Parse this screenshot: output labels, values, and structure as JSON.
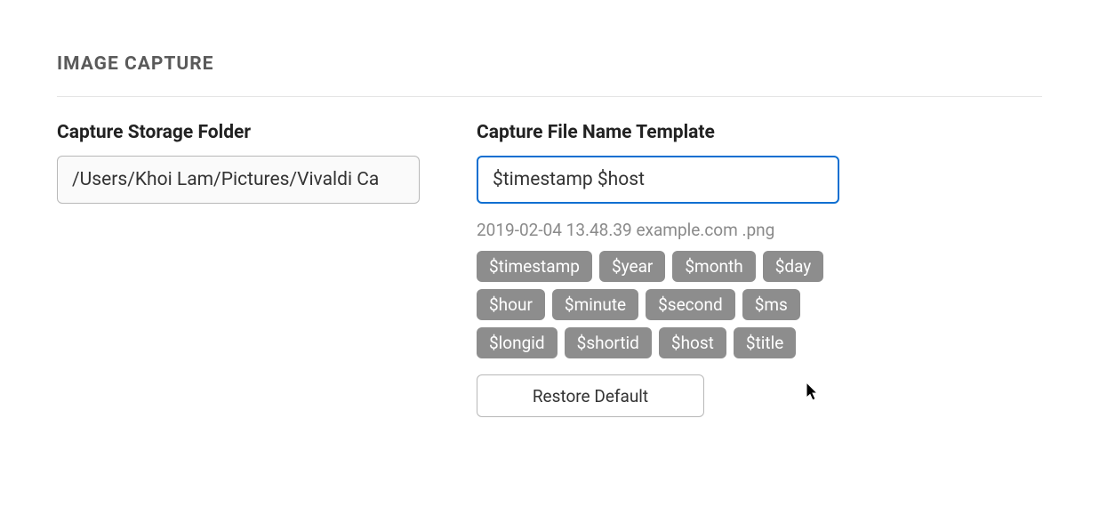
{
  "section": {
    "title": "IMAGE CAPTURE"
  },
  "storage": {
    "label": "Capture Storage Folder",
    "value": "/Users/Khoi Lam/Pictures/Vivaldi Ca"
  },
  "template": {
    "label": "Capture File Name Template",
    "value": "$timestamp $host",
    "preview": "2019-02-04 13.48.39 example.com .png",
    "chips": [
      "$timestamp",
      "$year",
      "$month",
      "$day",
      "$hour",
      "$minute",
      "$second",
      "$ms",
      "$longid",
      "$shortid",
      "$host",
      "$title"
    ],
    "restore_label": "Restore Default"
  }
}
